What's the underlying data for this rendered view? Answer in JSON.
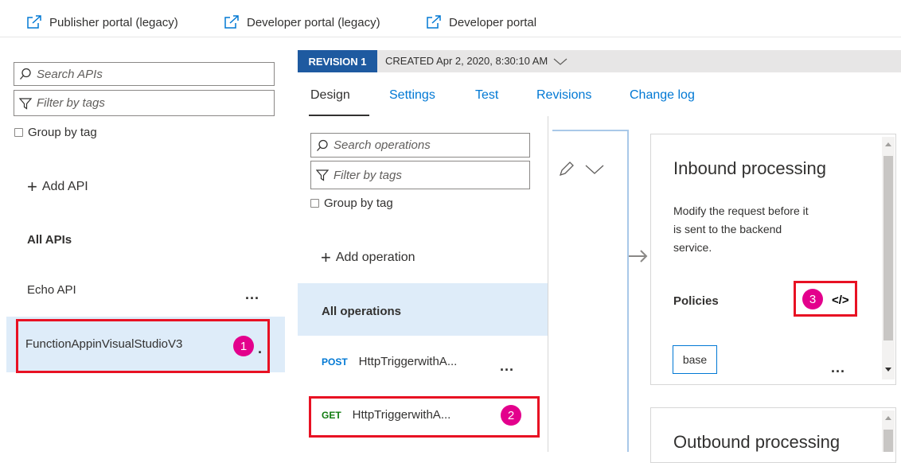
{
  "portal_links": [
    {
      "label": "Publisher portal (legacy)",
      "icon": "external-link-icon"
    },
    {
      "label": "Developer portal (legacy)",
      "icon": "external-link-icon"
    },
    {
      "label": "Developer portal",
      "icon": "external-link-icon"
    }
  ],
  "apis_pane": {
    "search_placeholder": "Search APIs",
    "filter_placeholder": "Filter by tags",
    "group_by_tag": "Group by tag",
    "add_api": "Add API",
    "all_apis": "All APIs",
    "items": [
      {
        "name": "Echo API",
        "more": "..."
      },
      {
        "name": "FunctionAppinVisualStudioV3",
        "more": ".",
        "selected": true
      }
    ]
  },
  "revision": {
    "tag": "REVISION 1",
    "created": "CREATED Apr 2, 2020, 8:30:10 AM"
  },
  "tabs": [
    "Design",
    "Settings",
    "Test",
    "Revisions",
    "Change log"
  ],
  "operations_pane": {
    "search_placeholder": "Search operations",
    "filter_placeholder": "Filter by tags",
    "group_by_tag": "Group by tag",
    "add_operation": "Add operation",
    "all_operations": "All operations",
    "operations": [
      {
        "method": "POST",
        "name": "HttpTriggerwithA...",
        "more": "...",
        "method_color": "#0078d4"
      },
      {
        "method": "GET",
        "name": "HttpTriggerwithA...",
        "method_color": "#107c10"
      }
    ]
  },
  "inbound": {
    "title": "Inbound processing",
    "description_line1": "Modify the request before it",
    "description_line2": "is sent to the backend",
    "description_line3": "service.",
    "policies_label": "Policies",
    "code_icon_text": "</>",
    "base_tag": "base",
    "more": "..."
  },
  "outbound": {
    "title": "Outbound processing"
  },
  "callouts": [
    "1",
    "2",
    "3"
  ],
  "colors": {
    "accent": "#0078d4",
    "revision_tag": "#1e5aa0",
    "callout_border": "#e81123",
    "callout_badge": "#e3008c",
    "selected_row": "#deecf9"
  }
}
